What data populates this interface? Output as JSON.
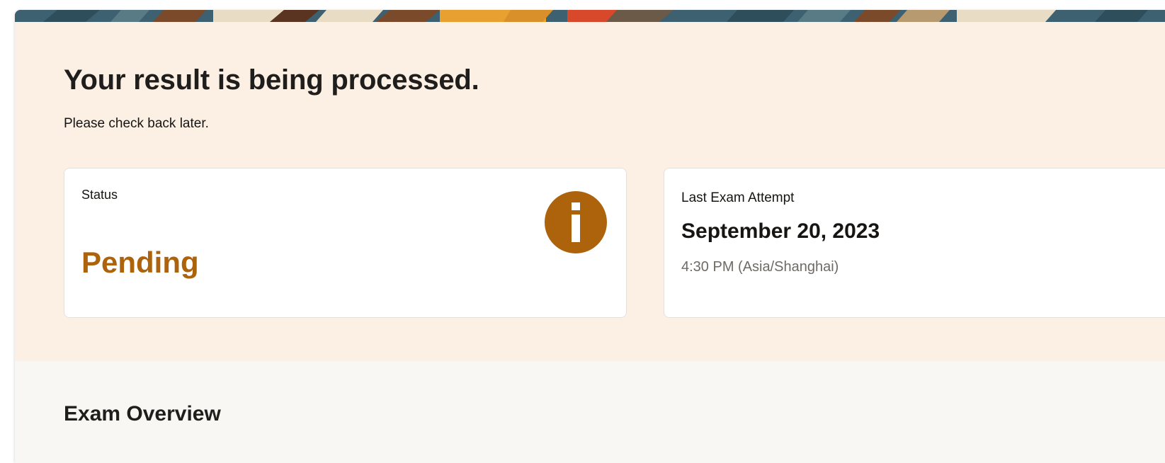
{
  "banner": {
    "colors": [
      "#3d6170",
      "#e8dcc4",
      "#7a4a2a",
      "#e8a030",
      "#d8482a",
      "#6b5a48"
    ]
  },
  "hero": {
    "title": "Your result is being processed.",
    "subtitle": "Please check back later."
  },
  "status_card": {
    "label": "Status",
    "value": "Pending",
    "icon": "info-icon",
    "accent_color": "#ac630c"
  },
  "attempt_card": {
    "label": "Last Exam Attempt",
    "date": "September 20, 2023",
    "time": "4:30 PM (Asia/Shanghai)"
  },
  "overview": {
    "title": "Exam Overview",
    "text": ""
  }
}
